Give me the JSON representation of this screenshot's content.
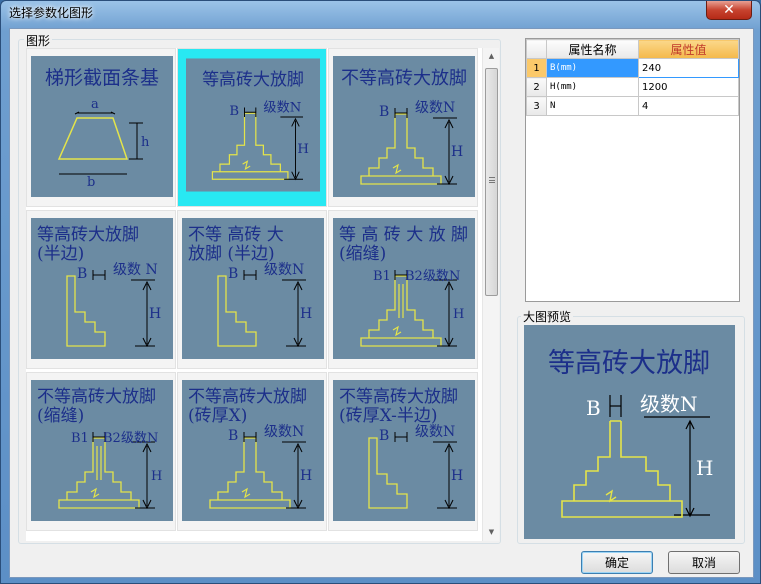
{
  "window": {
    "title": "选择参数化图形",
    "close_glyph": "✕"
  },
  "gallery": {
    "label": "图形",
    "tiles": [
      {
        "line1": "梯形截面条基",
        "line2": "",
        "labels": [
          "a",
          "h",
          "b"
        ],
        "selected": false
      },
      {
        "line1": "等高砖大放脚",
        "line2": "",
        "labels": [
          "B",
          "级数N",
          "H"
        ],
        "selected": true
      },
      {
        "line1": "不等高砖大放脚",
        "line2": "",
        "labels": [
          "B",
          "级数N",
          "H"
        ],
        "selected": false
      },
      {
        "line1": "等高砖大放脚",
        "line2": "(半边)",
        "labels": [
          "B",
          "级数 N",
          "H"
        ],
        "selected": false
      },
      {
        "line1": "不等 高砖 大",
        "line2": "放脚 (半边)",
        "labels": [
          "B",
          "级数N",
          "H"
        ],
        "selected": false
      },
      {
        "line1": "等 高 砖 大 放 脚",
        "line2": "(缩缝)",
        "labels": [
          "B1",
          "B2",
          "级数N",
          "H"
        ],
        "selected": false
      },
      {
        "line1": "不等高砖大放脚",
        "line2": "(缩缝)",
        "labels": [
          "B1",
          "B2",
          "级数N",
          "H"
        ],
        "selected": false
      },
      {
        "line1": "不等高砖大放脚",
        "line2": "(砖厚X)",
        "labels": [
          "B",
          "级数N",
          "H"
        ],
        "selected": false
      },
      {
        "line1": "不等高砖大放脚",
        "line2": "(砖厚X-半边)",
        "labels": [
          "B",
          "级数N",
          "H"
        ],
        "selected": false
      }
    ]
  },
  "properties": {
    "header_name": "属性名称",
    "header_value": "属性值",
    "rows": [
      {
        "index": "1",
        "name": "B(mm)",
        "value": "240"
      },
      {
        "index": "2",
        "name": "H(mm)",
        "value": "1200"
      },
      {
        "index": "3",
        "name": "N",
        "value": "4"
      }
    ]
  },
  "preview": {
    "label": "大图预览",
    "title": "等高砖大放脚",
    "labels": [
      "B",
      "级数N",
      "H"
    ]
  },
  "buttons": {
    "ok": "确定",
    "cancel": "取消"
  },
  "colors": {
    "tile_bg": "#6b8ba3",
    "drawing_line": "#e4e44a",
    "tile_text": "#1c2f8a",
    "selection": "#28e8f2"
  }
}
